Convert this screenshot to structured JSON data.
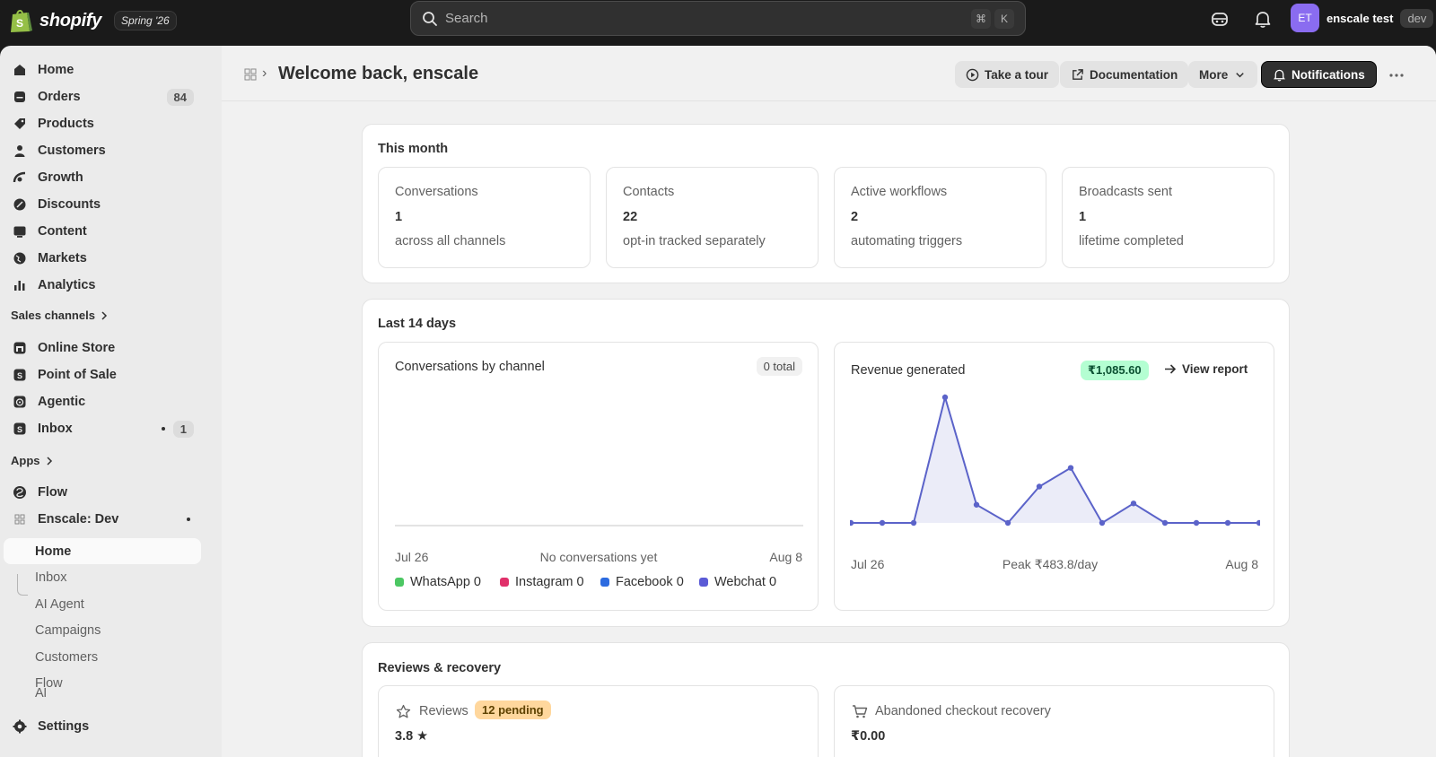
{
  "topbar": {
    "brand": "shopify",
    "edition_badge": "Spring '26",
    "search_placeholder": "Search",
    "shortcut_keys": [
      "⌘",
      "K"
    ],
    "account_initials": "ET",
    "account_name": "enscale test",
    "account_badge": "dev"
  },
  "sidebar": {
    "items": [
      {
        "label": "Home",
        "icon": "home-icon"
      },
      {
        "label": "Orders",
        "icon": "orders-icon",
        "count": "84"
      },
      {
        "label": "Products",
        "icon": "tag-icon"
      },
      {
        "label": "Customers",
        "icon": "person-icon"
      },
      {
        "label": "Growth",
        "icon": "growth-icon"
      },
      {
        "label": "Discounts",
        "icon": "discount-icon"
      },
      {
        "label": "Content",
        "icon": "content-icon"
      },
      {
        "label": "Markets",
        "icon": "globe-icon"
      },
      {
        "label": "Analytics",
        "icon": "bar-chart-icon"
      }
    ],
    "sales_channels_header": "Sales channels",
    "sales_channels": [
      {
        "label": "Online Store",
        "icon": "store-icon"
      },
      {
        "label": "Point of Sale",
        "icon": "pos-icon"
      },
      {
        "label": "Agentic",
        "icon": "agent-icon"
      },
      {
        "label": "Inbox",
        "icon": "inbox-icon",
        "count": "1"
      }
    ],
    "apps_header": "Apps",
    "apps": [
      {
        "label": "Flow",
        "icon": "flow-icon"
      },
      {
        "label": "Enscale: Dev",
        "icon": "app-grid-icon"
      }
    ],
    "app_subitems": [
      "Home",
      "Inbox",
      "AI Agent",
      "Campaigns",
      "Customers",
      "Flow",
      "Al"
    ],
    "settings_label": "Settings"
  },
  "header": {
    "title": "Welcome back, enscale",
    "buttons": {
      "tour": "Take a tour",
      "docs": "Documentation",
      "more": "More",
      "notifications": "Notifications"
    }
  },
  "this_month": {
    "title": "This month",
    "stats": [
      {
        "label": "Conversations",
        "value": "1",
        "sub": "across all channels"
      },
      {
        "label": "Contacts",
        "value": "22",
        "sub": "opt-in tracked separately"
      },
      {
        "label": "Active workflows",
        "value": "2",
        "sub": "automating triggers"
      },
      {
        "label": "Broadcasts sent",
        "value": "1",
        "sub": "lifetime completed"
      }
    ]
  },
  "last14": {
    "title": "Last 14 days",
    "conversations": {
      "title": "Conversations by channel",
      "total_badge": "0 total",
      "start": "Jul 26",
      "empty": "No conversations yet",
      "end": "Aug 8",
      "legend": [
        {
          "label": "WhatsApp 0",
          "color": "#4cc763"
        },
        {
          "label": "Instagram 0",
          "color": "#e0306a"
        },
        {
          "label": "Facebook 0",
          "color": "#2c6be0"
        },
        {
          "label": "Webchat 0",
          "color": "#5b5bd6"
        }
      ]
    },
    "revenue": {
      "title": "Revenue generated",
      "amount_badge": "₹1,085.60",
      "view_report": "View report",
      "start": "Jul 26",
      "peak": "Peak ₹483.8/day",
      "end": "Aug 8"
    }
  },
  "chart_data": {
    "type": "area",
    "x": [
      "Jul 26",
      "Jul 27",
      "Jul 28",
      "Jul 29",
      "Jul 30",
      "Jul 31",
      "Aug 1",
      "Aug 2",
      "Aug 3",
      "Aug 4",
      "Aug 5",
      "Aug 6",
      "Aug 7",
      "Aug 8"
    ],
    "series": [
      {
        "values": [
          0,
          0,
          0,
          483.8,
          70,
          0,
          140,
          212,
          0,
          75,
          0,
          0,
          0,
          0
        ]
      }
    ],
    "ylim": [
      0,
      483.8
    ],
    "color": "#5b63c9"
  },
  "reviews": {
    "title": "Reviews & recovery",
    "reviews_label": "Reviews",
    "pending_badge": "12 pending",
    "rating": "3.8 ★",
    "abandoned_label": "Abandoned checkout recovery",
    "abandoned_value": "₹0.00"
  }
}
